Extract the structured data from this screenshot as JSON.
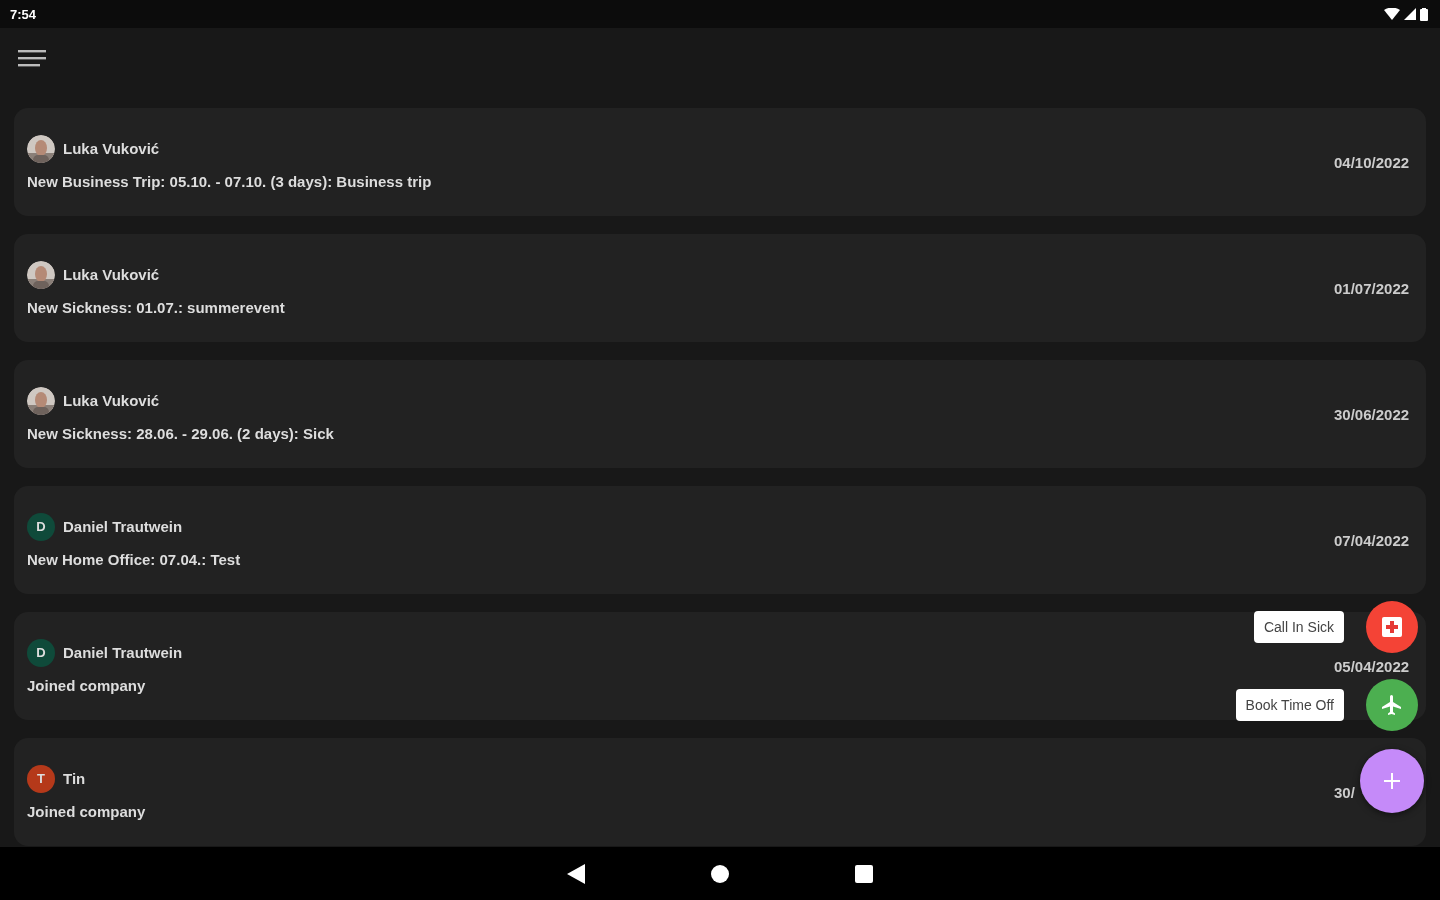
{
  "status_bar": {
    "time": "7:54"
  },
  "feed": [
    {
      "name": "Luka Vuković",
      "text": "New Business Trip: 05.10. - 07.10. (3 days): Business trip",
      "date": "04/10/2022"
    },
    {
      "name": "Luka Vuković",
      "text": "New Sickness: 01.07.: summerevent",
      "date": "01/07/2022"
    },
    {
      "name": "Luka Vuković",
      "text": "New Sickness: 28.06. - 29.06. (2 days): Sick",
      "date": "30/06/2022"
    },
    {
      "name": "Daniel Trautwein",
      "avatar": {
        "kind": "letter",
        "letter": "D",
        "color": "#0f4a3a"
      },
      "text": "New Home Office: 07.04.: Test",
      "date": "07/04/2022"
    },
    {
      "name": "Daniel Trautwein",
      "avatar": {
        "kind": "letter",
        "letter": "D",
        "color": "#0f4a3a"
      },
      "text": "Joined company",
      "date": "05/04/2022"
    },
    {
      "name": "Tin",
      "avatar": {
        "kind": "letter",
        "letter": "T",
        "color": "#b5391a"
      },
      "text": "Joined company",
      "date": "30/"
    }
  ],
  "speed_dial": {
    "actions": [
      {
        "label": "Call In Sick",
        "kind": "sick",
        "color": "#f44336"
      },
      {
        "label": "Book Time Off",
        "kind": "plane",
        "color": "#4caf50"
      },
      {
        "kind": "add",
        "color": "#c58af9"
      }
    ]
  }
}
